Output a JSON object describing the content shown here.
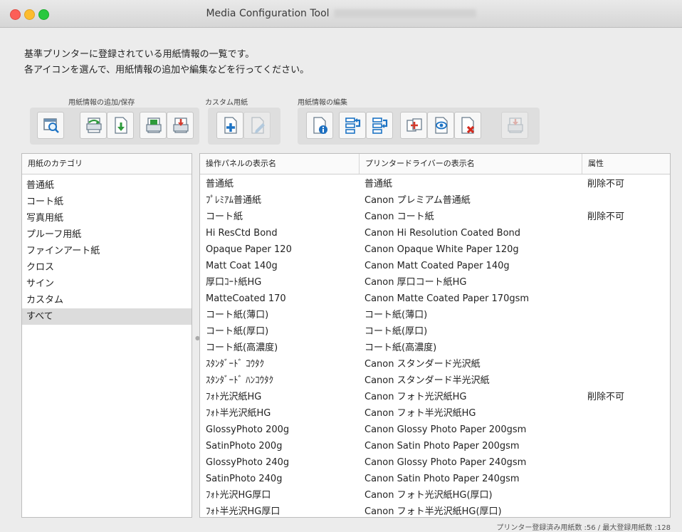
{
  "window": {
    "title": "Media Configuration Tool"
  },
  "description": {
    "line1": "基準プリンターに登録されている用紙情報の一覧です。",
    "line2": "各アイコンを選んで、用紙情報の追加や編集などを行ってください。"
  },
  "toolbar": {
    "groups": [
      {
        "label": "用紙情報の追加/保存"
      },
      {
        "label": "カスタム用紙"
      },
      {
        "label": "用紙情報の編集"
      }
    ],
    "icons": [
      "printer-search-icon",
      "printer-add-icon",
      "download-icon",
      "printer-save-icon",
      "printer-export-icon",
      "custom-add-icon",
      "custom-edit-icon",
      "info-icon",
      "move-up-icon",
      "move-down-icon",
      "duplicate-icon",
      "preview-icon",
      "delete-icon",
      "printer-disabled-icon"
    ]
  },
  "categories": {
    "header": "用紙のカテゴリ",
    "items": [
      "普通紙",
      "コート紙",
      "写真用紙",
      "プルーフ用紙",
      "ファインアート紙",
      "クロス",
      "サイン",
      "カスタム",
      "すべて"
    ],
    "selected_index": 8
  },
  "media_table": {
    "headers": [
      "操作パネルの表示名",
      "プリンタードライバーの表示名",
      "属性"
    ],
    "rows": [
      [
        "普通紙",
        "普通紙",
        "削除不可"
      ],
      [
        "ﾌﾟﾚﾐｱﾑ普通紙",
        "Canon プレミアム普通紙",
        ""
      ],
      [
        "コート紙",
        "Canon コート紙",
        "削除不可"
      ],
      [
        "Hi ResCtd Bond",
        "Canon Hi Resolution Coated Bond",
        ""
      ],
      [
        "Opaque Paper 120",
        "Canon Opaque White Paper 120g",
        ""
      ],
      [
        "Matt Coat 140g",
        "Canon Matt Coated Paper 140g",
        ""
      ],
      [
        "厚口ｺｰﾄ紙HG",
        "Canon 厚口コート紙HG",
        ""
      ],
      [
        "MatteCoated 170",
        "Canon Matte Coated Paper 170gsm",
        ""
      ],
      [
        "コート紙(薄口)",
        "コート紙(薄口)",
        ""
      ],
      [
        "コート紙(厚口)",
        "コート紙(厚口)",
        ""
      ],
      [
        "コート紙(高濃度)",
        "コート紙(高濃度)",
        ""
      ],
      [
        "ｽﾀﾝﾀﾞｰﾄﾞ ｺｳﾀｸ",
        "Canon スタンダード光沢紙",
        ""
      ],
      [
        "ｽﾀﾝﾀﾞｰﾄﾞ ﾊﾝｺｳﾀｸ",
        "Canon スタンダード半光沢紙",
        ""
      ],
      [
        "ﾌｫﾄ光沢紙HG",
        "Canon フォト光沢紙HG",
        "削除不可"
      ],
      [
        "ﾌｫﾄ半光沢紙HG",
        "Canon フォト半光沢紙HG",
        ""
      ],
      [
        "GlossyPhoto 200g",
        "Canon Glossy Photo Paper 200gsm",
        ""
      ],
      [
        "SatinPhoto 200g",
        "Canon Satin Photo Paper 200gsm",
        ""
      ],
      [
        "GlossyPhoto 240g",
        "Canon Glossy Photo Paper 240gsm",
        ""
      ],
      [
        "SatinPhoto 240g",
        "Canon Satin Photo Paper 240gsm",
        ""
      ],
      [
        "ﾌｫﾄ光沢HG厚口",
        "Canon フォト光沢紙HG(厚口)",
        ""
      ],
      [
        "ﾌｫﾄ半光沢HG厚口",
        "Canon フォト半光沢紙HG(厚口)",
        ""
      ]
    ]
  },
  "status_bar": {
    "text": "プリンター登録済み用紙数 :56 / 最大登録用紙数 :128"
  }
}
